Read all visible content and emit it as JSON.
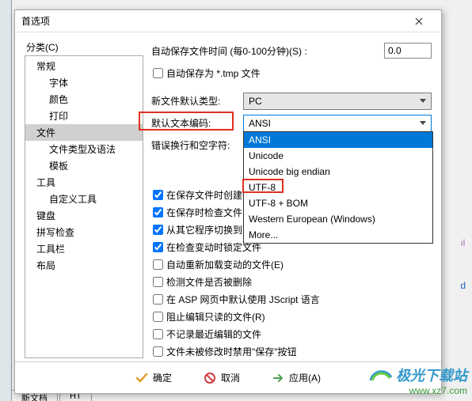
{
  "dialog": {
    "title": "首选项",
    "category_label": "分类(C)"
  },
  "tree": [
    {
      "label": "常规",
      "level": 0
    },
    {
      "label": "字体",
      "level": 1
    },
    {
      "label": "颜色",
      "level": 1
    },
    {
      "label": "打印",
      "level": 1
    },
    {
      "label": "文件",
      "level": 0,
      "selected": true
    },
    {
      "label": "文件类型及语法",
      "level": 1
    },
    {
      "label": "模板",
      "level": 1
    },
    {
      "label": "工具",
      "level": 0
    },
    {
      "label": "自定义工具",
      "level": 1
    },
    {
      "label": "键盘",
      "level": 0
    },
    {
      "label": "拼写检查",
      "level": 0
    },
    {
      "label": "工具栏",
      "level": 0
    },
    {
      "label": "布局",
      "level": 0
    }
  ],
  "form": {
    "autosave_label": "自动保存文件时间 (每0-100分钟)(S) :",
    "autosave_value": "0.0",
    "autosave_tmp": "自动保存为 *.tmp 文件",
    "default_type_label": "新文件默认类型:",
    "default_type_value": "PC",
    "encoding_label": "默认文本编码:",
    "encoding_value": "ANSI",
    "wrap_label": "错误换行和空字符:"
  },
  "encoding_options": [
    {
      "label": "ANSI",
      "hi": true
    },
    {
      "label": "Unicode"
    },
    {
      "label": "Unicode big endian"
    },
    {
      "label": "UTF-8",
      "red": true
    },
    {
      "label": "UTF-8 + BOM"
    },
    {
      "label": "Western European (Windows)"
    },
    {
      "label": "More..."
    }
  ],
  "checks": [
    {
      "label": "在保存文件时创建备",
      "checked": true
    },
    {
      "label": "在保存时检查文件的",
      "checked": true
    },
    {
      "label": "从其它程序切换到 E",
      "checked": true
    },
    {
      "label": "在检查变动时锁定文件",
      "checked": true
    },
    {
      "label": "自动重新加载变动的文件(E)",
      "checked": false
    },
    {
      "label": "检测文件是否被删除",
      "checked": false
    },
    {
      "label": "在 ASP 网页中默认使用 JScript 语言",
      "checked": false
    },
    {
      "label": "阻止编辑只读的文件(R)",
      "checked": false
    },
    {
      "label": "不记录最近编辑的文件",
      "checked": false
    },
    {
      "label": "文件未被修改时禁用\"保存\"按钮",
      "checked": false
    }
  ],
  "footer": {
    "ok": "确定",
    "cancel": "取消",
    "apply": "应用(A)"
  },
  "watermark": {
    "brand": "极光下载站",
    "url": "www.xz7.com"
  },
  "bg": {
    "t1": "ıl",
    "t2": "d"
  },
  "tabs": {
    "t1": "新文档",
    "t2": "HT"
  }
}
